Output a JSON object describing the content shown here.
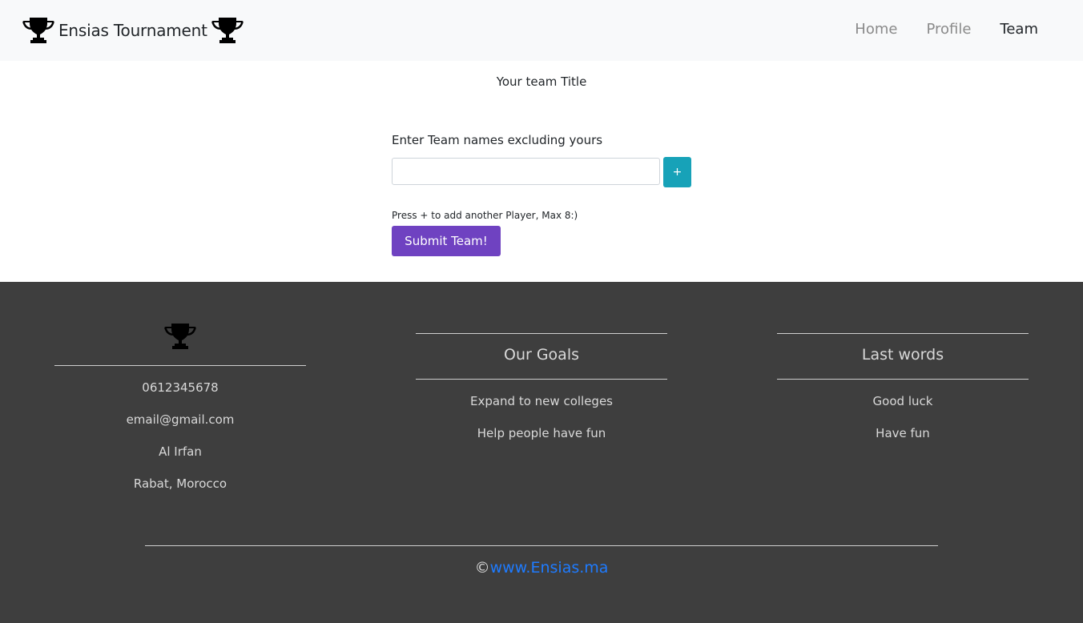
{
  "navbar": {
    "brand": "Ensias Tournament",
    "links": [
      {
        "label": "Home"
      },
      {
        "label": "Profile"
      },
      {
        "label": "Team"
      }
    ]
  },
  "main": {
    "team_title": "Your team Title",
    "form_label": "Enter Team names excluding yours",
    "player_input_value": "",
    "add_button": "+",
    "hint": "Press + to add another Player, Max 8:)",
    "submit_button": "Submit Team!"
  },
  "footer": {
    "contact": {
      "icon": "trophy-icon",
      "items": [
        "0612345678",
        "email@gmail.com",
        "Al Irfan",
        "Rabat, Morocco"
      ]
    },
    "goals": {
      "heading": "Our Goals",
      "items": [
        "Expand to new colleges",
        "Help people have fun"
      ]
    },
    "last_words": {
      "heading": "Last words",
      "items": [
        "Good luck",
        "Have fun"
      ]
    },
    "copyright_symbol": "©",
    "site_link": "www.Ensias.ma"
  },
  "colors": {
    "navbar_bg": "#f8f9fa",
    "footer_bg": "#3e3e3e",
    "add_button": "#17a2b8",
    "submit_button": "#6f42c1",
    "link": "#1e7bff"
  }
}
